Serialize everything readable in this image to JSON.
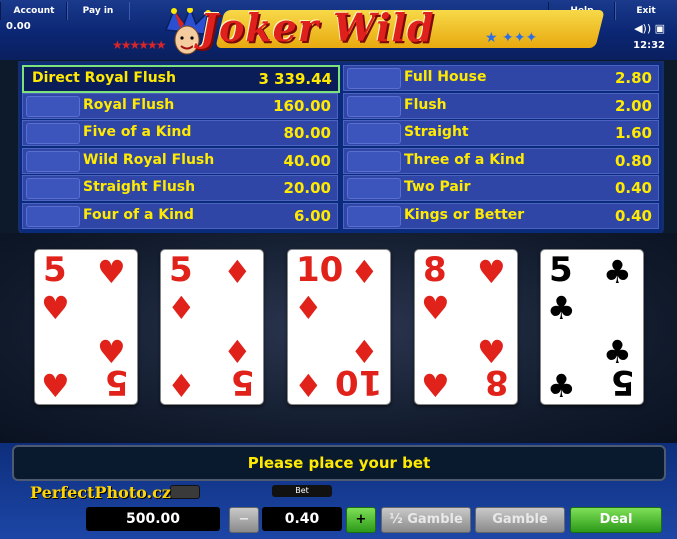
{
  "menu": {
    "account": "Account",
    "payin": "Pay in",
    "help": "Help",
    "exit": "Exit"
  },
  "status": {
    "credit": "0.00",
    "time": "12:32"
  },
  "logo": {
    "text": "Joker Wild"
  },
  "paytable": {
    "left": [
      {
        "name": "Direct Royal Flush",
        "value": "3 339.44",
        "highlight": true
      },
      {
        "name": "Royal Flush",
        "value": "160.00"
      },
      {
        "name": "Five of a Kind",
        "value": "80.00"
      },
      {
        "name": "Wild Royal Flush",
        "value": "40.00"
      },
      {
        "name": "Straight Flush",
        "value": "20.00"
      },
      {
        "name": "Four of a Kind",
        "value": "6.00"
      }
    ],
    "right": [
      {
        "name": "Full House",
        "value": "2.80"
      },
      {
        "name": "Flush",
        "value": "2.00"
      },
      {
        "name": "Straight",
        "value": "1.60"
      },
      {
        "name": "Three of a Kind",
        "value": "0.80"
      },
      {
        "name": "Two Pair",
        "value": "0.40"
      },
      {
        "name": "Kings or Better",
        "value": "0.40"
      }
    ]
  },
  "cards": [
    {
      "rank": "5",
      "suit": "♥",
      "color": "red"
    },
    {
      "rank": "5",
      "suit": "♦",
      "color": "red"
    },
    {
      "rank": "10",
      "suit": "♦",
      "color": "red"
    },
    {
      "rank": "8",
      "suit": "♥",
      "color": "red"
    },
    {
      "rank": "5",
      "suit": "♣",
      "color": "black"
    }
  ],
  "message": "Please place your bet",
  "watermark": "PerfectPhoto.cz",
  "controls": {
    "bet_label": "Bet",
    "balance": "500.00",
    "minus": "−",
    "bet_value": "0.40",
    "plus": "+",
    "half_gamble": "½ Gamble",
    "gamble": "Gamble",
    "deal": "Deal"
  },
  "colors": {
    "paytable_text": "#ffea00",
    "highlight_border": "#7ee27a",
    "deal_button": "#2c9a1a"
  }
}
